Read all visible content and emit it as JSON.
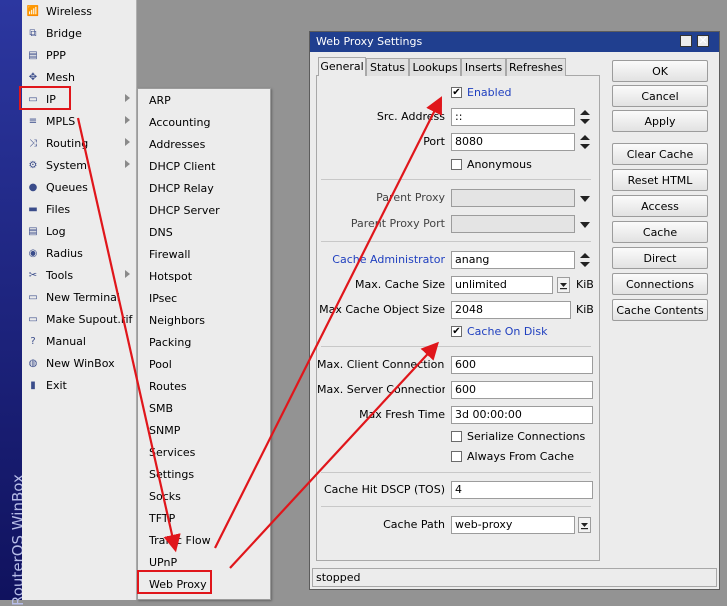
{
  "brand": "RouterOS WinBox",
  "main_menu": [
    {
      "label": "Wireless",
      "icon": "wireless-icon",
      "has_submenu": false
    },
    {
      "label": "Bridge",
      "icon": "bridge-icon",
      "has_submenu": false
    },
    {
      "label": "PPP",
      "icon": "ppp-icon",
      "has_submenu": false
    },
    {
      "label": "Mesh",
      "icon": "mesh-icon",
      "has_submenu": false
    },
    {
      "label": "IP",
      "icon": "ip-icon",
      "has_submenu": true
    },
    {
      "label": "MPLS",
      "icon": "mpls-icon",
      "has_submenu": true
    },
    {
      "label": "Routing",
      "icon": "routing-icon",
      "has_submenu": true
    },
    {
      "label": "System",
      "icon": "system-icon",
      "has_submenu": true
    },
    {
      "label": "Queues",
      "icon": "queues-icon",
      "has_submenu": false
    },
    {
      "label": "Files",
      "icon": "files-icon",
      "has_submenu": false
    },
    {
      "label": "Log",
      "icon": "log-icon",
      "has_submenu": false
    },
    {
      "label": "Radius",
      "icon": "radius-icon",
      "has_submenu": false
    },
    {
      "label": "Tools",
      "icon": "tools-icon",
      "has_submenu": true
    },
    {
      "label": "New Terminal",
      "icon": "terminal-icon",
      "has_submenu": false
    },
    {
      "label": "Make Supout.rif",
      "icon": "supout-icon",
      "has_submenu": false
    },
    {
      "label": "Manual",
      "icon": "manual-icon",
      "has_submenu": false
    },
    {
      "label": "New WinBox",
      "icon": "winbox-icon",
      "has_submenu": false
    },
    {
      "label": "Exit",
      "icon": "exit-icon",
      "has_submenu": false
    }
  ],
  "ip_submenu": [
    "ARP",
    "Accounting",
    "Addresses",
    "DHCP Client",
    "DHCP Relay",
    "DHCP Server",
    "DNS",
    "Firewall",
    "Hotspot",
    "IPsec",
    "Neighbors",
    "Packing",
    "Pool",
    "Routes",
    "SMB",
    "SNMP",
    "Services",
    "Settings",
    "Socks",
    "TFTP",
    "Traffic Flow",
    "UPnP",
    "Web Proxy"
  ],
  "window": {
    "title": "Web Proxy Settings",
    "tabs": [
      "General",
      "Status",
      "Lookups",
      "Inserts",
      "Refreshes"
    ],
    "active_tab": "General",
    "enabled_label": "Enabled",
    "src_address_label": "Src. Address",
    "src_address_value": "::",
    "port_label": "Port",
    "port_value": "8080",
    "anonymous_label": "Anonymous",
    "parent_proxy_label": "Parent Proxy",
    "parent_proxy_port_label": "Parent Proxy Port",
    "cache_admin_label": "Cache Administrator",
    "cache_admin_value": "anang",
    "max_cache_size_label": "Max. Cache Size",
    "max_cache_size_value": "unlimited",
    "max_cache_size_unit": "KiB",
    "max_cache_obj_label": "Max Cache Object Size",
    "max_cache_obj_value": "2048",
    "max_cache_obj_unit": "KiB",
    "cache_on_disk_label": "Cache On Disk",
    "max_client_label": "Max. Client Connections",
    "max_client_value": "600",
    "max_server_label": "Max. Server Connections",
    "max_server_value": "600",
    "max_fresh_label": "Max Fresh Time",
    "max_fresh_value": "3d 00:00:00",
    "serialize_label": "Serialize Connections",
    "always_cache_label": "Always From Cache",
    "dscp_label": "Cache Hit DSCP (TOS)",
    "dscp_value": "4",
    "cache_path_label": "Cache Path",
    "cache_path_value": "web-proxy",
    "status": "stopped",
    "buttons": [
      "OK",
      "Cancel",
      "Apply",
      "Clear Cache",
      "Reset HTML",
      "Access",
      "Cache",
      "Direct",
      "Connections",
      "Cache Contents"
    ]
  },
  "colors": {
    "accent_link": "#1f3fbf",
    "annotation_red": "#e0161b",
    "titlebar": "#203f8f"
  }
}
